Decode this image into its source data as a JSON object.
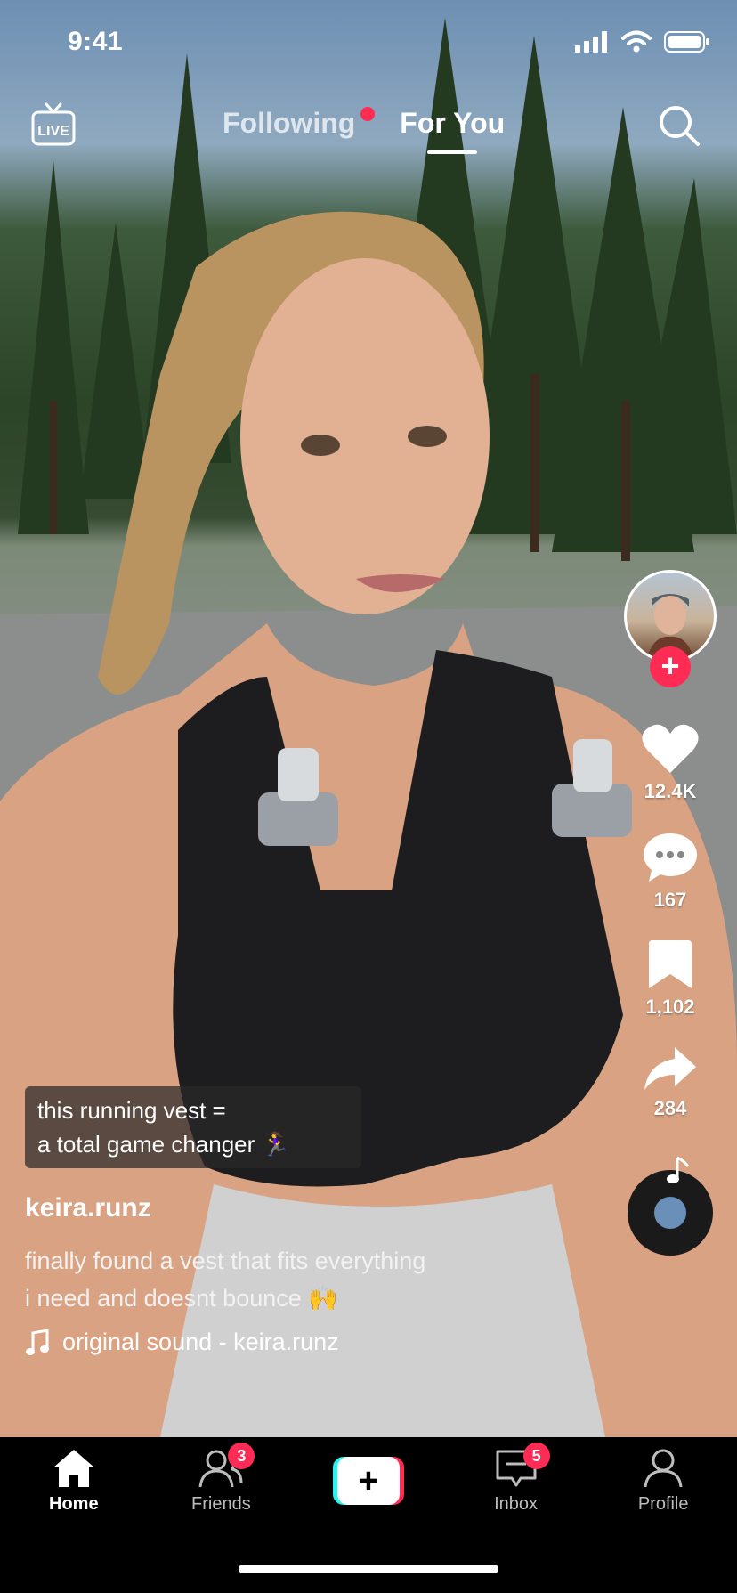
{
  "status": {
    "time": "9:41"
  },
  "topnav": {
    "live_label": "LIVE",
    "tabs": [
      {
        "label": "Following",
        "has_dot": true
      },
      {
        "label": "For You",
        "active": true
      }
    ]
  },
  "video": {
    "overlay_caption_line1": "this running vest =",
    "overlay_caption_line2": "a total game changer 🏃‍♀️",
    "username": "keira.runz",
    "description_line1": "finally found a vest that fits everything",
    "description_line2": "i need and doesnt bounce 🙌",
    "sound": "original sound - keira.runz"
  },
  "actions": {
    "likes": "12.4K",
    "comments": "167",
    "saves": "1,102",
    "shares": "284"
  },
  "bottom_nav": {
    "home": "Home",
    "friends": "Friends",
    "friends_badge": "3",
    "inbox": "Inbox",
    "inbox_badge": "5",
    "profile": "Profile"
  },
  "colors": {
    "accent": "#fe2c55",
    "cyan": "#25f4ee"
  },
  "icons": [
    "live-tv-icon",
    "search-icon",
    "heart-icon",
    "comment-icon",
    "bookmark-icon",
    "share-icon",
    "music-note-icon",
    "home-icon",
    "friends-icon",
    "inbox-icon",
    "profile-icon",
    "plus-icon"
  ]
}
